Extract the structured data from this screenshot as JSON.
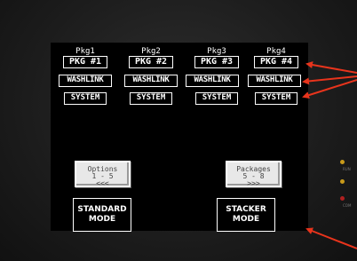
{
  "columns": [
    {
      "label": "Pkg1",
      "pkg": "PKG #1",
      "wash": "WASHLINK",
      "sys": "SYSTEM"
    },
    {
      "label": "Pkg2",
      "pkg": "PKG #2",
      "wash": "WASHLINK",
      "sys": "SYSTEM"
    },
    {
      "label": "Pkg3",
      "pkg": "PKG #3",
      "wash": "WASHLINK",
      "sys": "SYSTEM"
    },
    {
      "label": "Pkg4",
      "pkg": "PKG #4",
      "wash": "WASHLINK",
      "sys": "SYSTEM"
    }
  ],
  "options_button": {
    "line1": "Options",
    "line2": "1 - 5",
    "line3": "<<<"
  },
  "packages_button": {
    "line1": "Packages",
    "line2": "5 - 8",
    "line3": ">>>"
  },
  "standard_mode": {
    "line1": "STANDARD",
    "line2": "MODE"
  },
  "stacker_mode": {
    "line1": "STACKER",
    "line2": "MODE"
  },
  "leds": [
    {
      "label": "RUN",
      "color": "#c89a1a"
    },
    {
      "label": "",
      "color": "#c89a1a"
    },
    {
      "label": "COM",
      "color": "#b02020"
    }
  ],
  "colors": {
    "annotation_arrows": "#e8341c"
  }
}
